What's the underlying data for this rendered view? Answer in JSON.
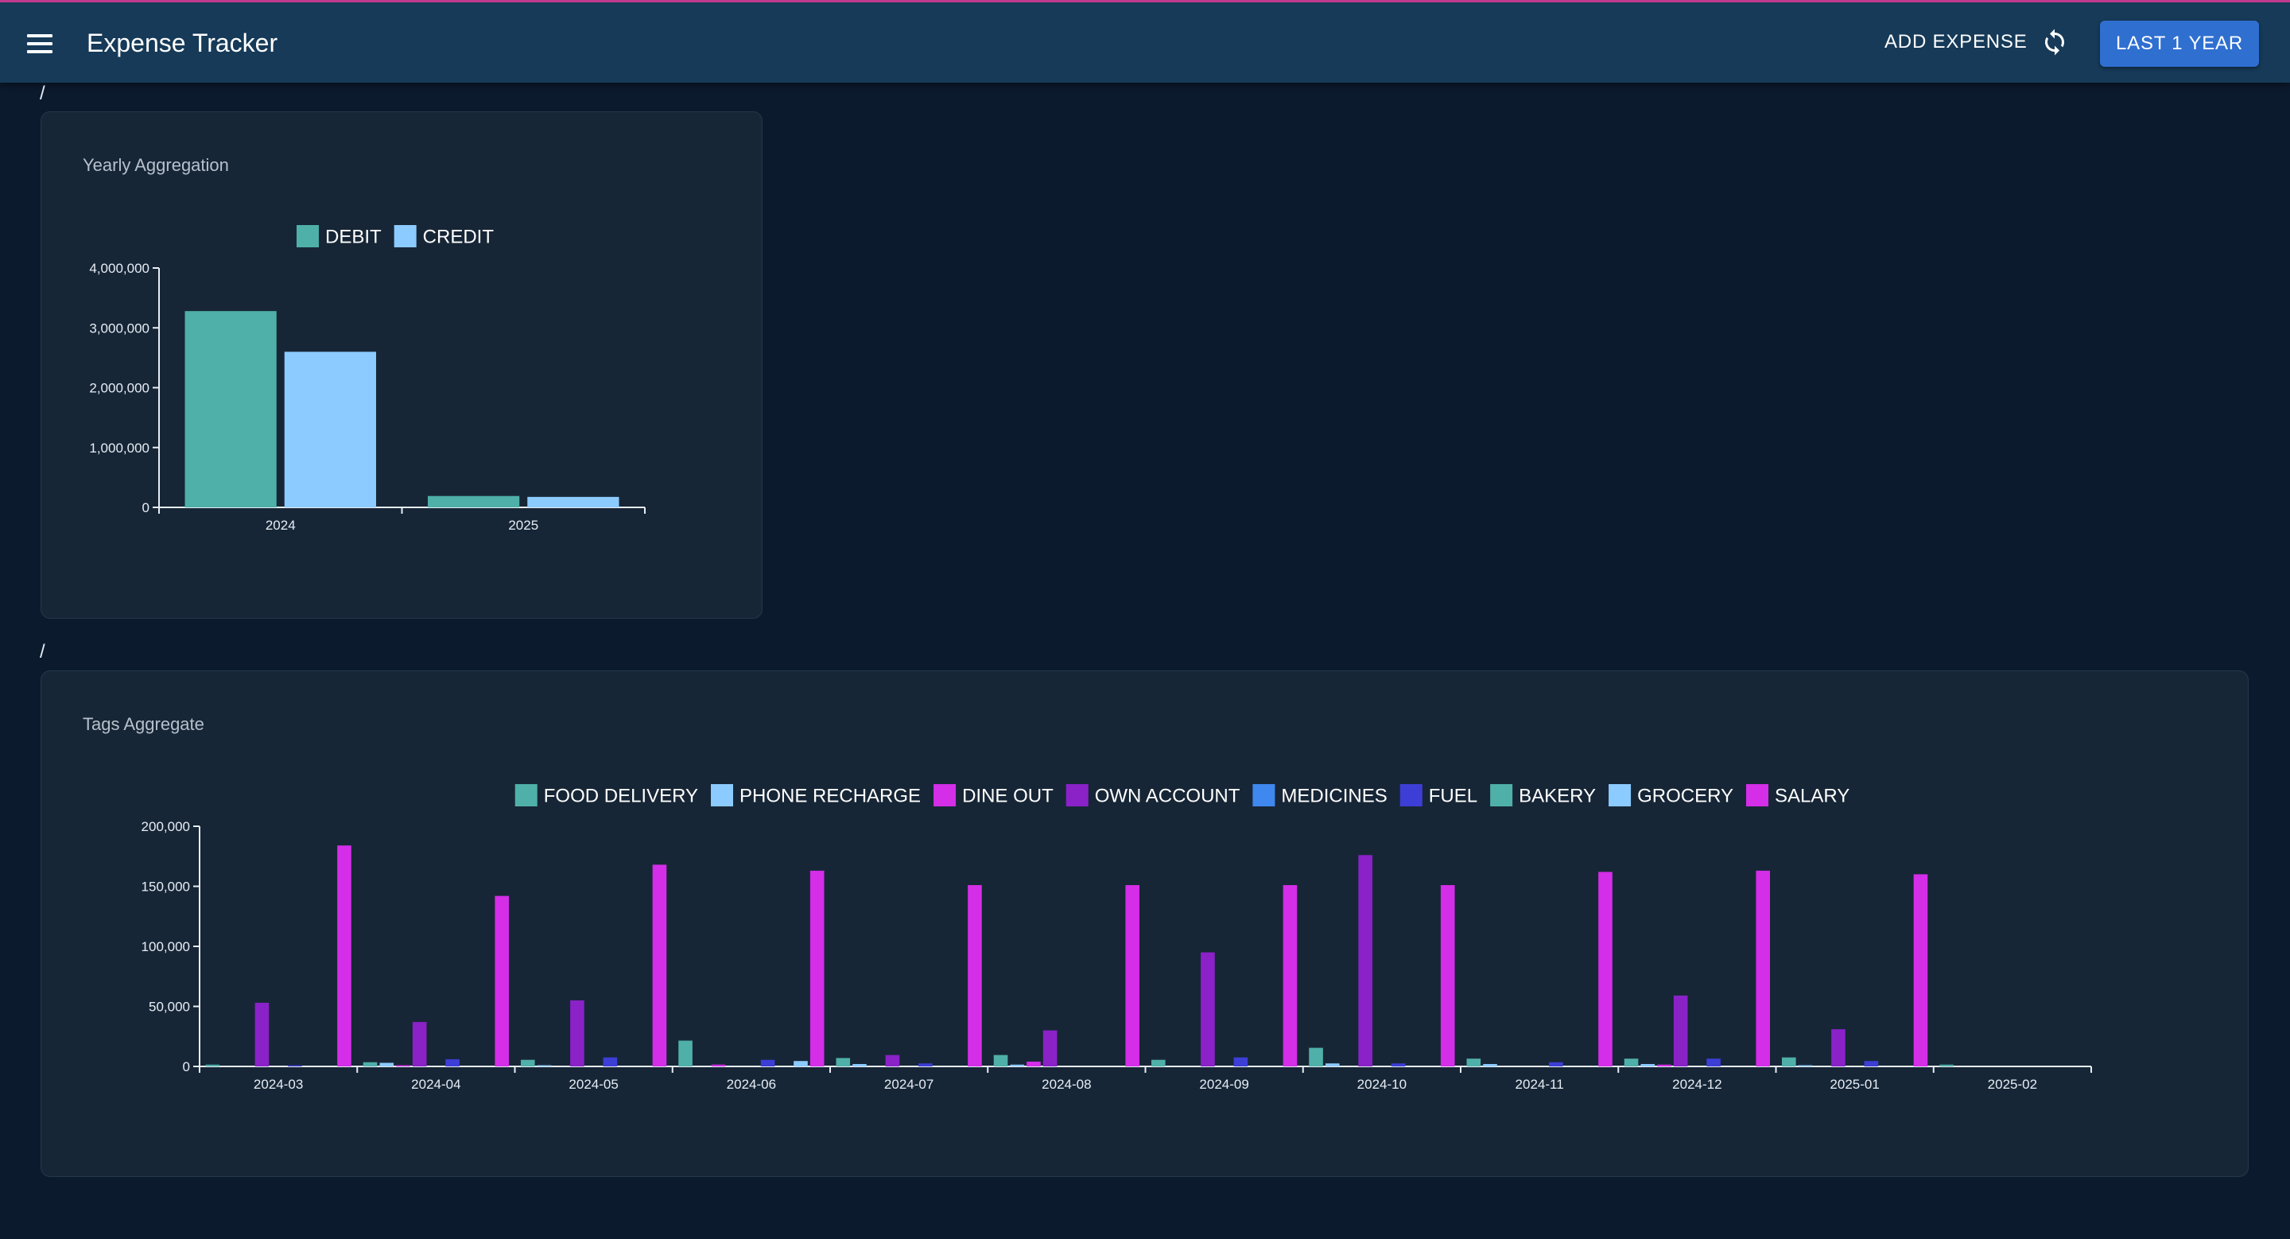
{
  "header": {
    "title": "Expense Tracker",
    "add_expense_label": "ADD EXPENSE",
    "range_label": "LAST 1 YEAR",
    "icons": {
      "menu": "menu-icon",
      "refresh": "refresh-icon"
    }
  },
  "breadcrumbs": [
    "/",
    "/"
  ],
  "colors": {
    "appbar": "#163a58",
    "button": "#2f6fd0",
    "debit": "#4fb0a9",
    "credit": "#8ccbff"
  },
  "cards": {
    "yearly": {
      "title": "Yearly Aggregation"
    },
    "tags": {
      "title": "Tags Aggregate"
    }
  },
  "chart_data": [
    {
      "type": "bar",
      "title": "Yearly Aggregation",
      "categories": [
        "2024",
        "2025"
      ],
      "series": [
        {
          "name": "DEBIT",
          "color": "#4fb0a9",
          "values": [
            3280000,
            190000
          ]
        },
        {
          "name": "CREDIT",
          "color": "#8ccbff",
          "values": [
            2600000,
            175000
          ]
        }
      ],
      "ylim": [
        0,
        4000000
      ],
      "yticks": [
        0,
        1000000,
        2000000,
        3000000,
        4000000
      ],
      "ytick_labels": [
        "0",
        "1,000,000",
        "2,000,000",
        "3,000,000",
        "4,000,000"
      ],
      "legend": "top-center"
    },
    {
      "type": "bar",
      "title": "Tags Aggregate",
      "categories": [
        "2024-03",
        "2024-04",
        "2024-05",
        "2024-06",
        "2024-07",
        "2024-08",
        "2024-09",
        "2024-10",
        "2024-11",
        "2024-12",
        "2025-01",
        "2025-02"
      ],
      "series": [
        {
          "name": "FOOD DELIVERY",
          "color": "#4fb0a9",
          "values": [
            1500,
            3500,
            5500,
            21500,
            7000,
            9500,
            5500,
            15500,
            6500,
            6500,
            7500,
            1500
          ]
        },
        {
          "name": "PHONE RECHARGE",
          "color": "#8ccbff",
          "values": [
            0,
            3000,
            1000,
            0,
            2000,
            1500,
            0,
            2500,
            2000,
            2000,
            1000,
            0
          ]
        },
        {
          "name": "DINE OUT",
          "color": "#d42ee8",
          "values": [
            0,
            1000,
            0,
            1500,
            0,
            4000,
            0,
            0,
            0,
            1500,
            0,
            0
          ]
        },
        {
          "name": "OWN ACCOUNT",
          "color": "#8a22c8",
          "values": [
            53000,
            37000,
            55000,
            0,
            9500,
            30000,
            95000,
            176000,
            0,
            59000,
            31000,
            0
          ]
        },
        {
          "name": "MEDICINES",
          "color": "#3f88f0",
          "values": [
            0,
            0,
            0,
            0,
            0,
            0,
            0,
            0,
            0,
            0,
            0,
            0
          ]
        },
        {
          "name": "FUEL",
          "color": "#3d3ed6",
          "values": [
            1000,
            6000,
            7500,
            5500,
            2500,
            0,
            7500,
            2500,
            3500,
            6500,
            4500,
            0
          ]
        },
        {
          "name": "BAKERY",
          "color": "#4fb0a9",
          "values": [
            0,
            0,
            0,
            0,
            0,
            0,
            0,
            0,
            0,
            0,
            0,
            0
          ]
        },
        {
          "name": "GROCERY",
          "color": "#8ccbff",
          "values": [
            0,
            0,
            0,
            4500,
            0,
            0,
            0,
            0,
            0,
            0,
            0,
            0
          ]
        },
        {
          "name": "SALARY",
          "color": "#d42ee8",
          "values": [
            184000,
            142000,
            168000,
            163000,
            151000,
            151000,
            151000,
            151000,
            162000,
            163000,
            160000,
            0
          ]
        }
      ],
      "ylim": [
        0,
        200000
      ],
      "yticks": [
        0,
        50000,
        100000,
        150000,
        200000
      ],
      "ytick_labels": [
        "0",
        "50,000",
        "100,000",
        "150,000",
        "200,000"
      ],
      "legend": "top-center"
    }
  ]
}
